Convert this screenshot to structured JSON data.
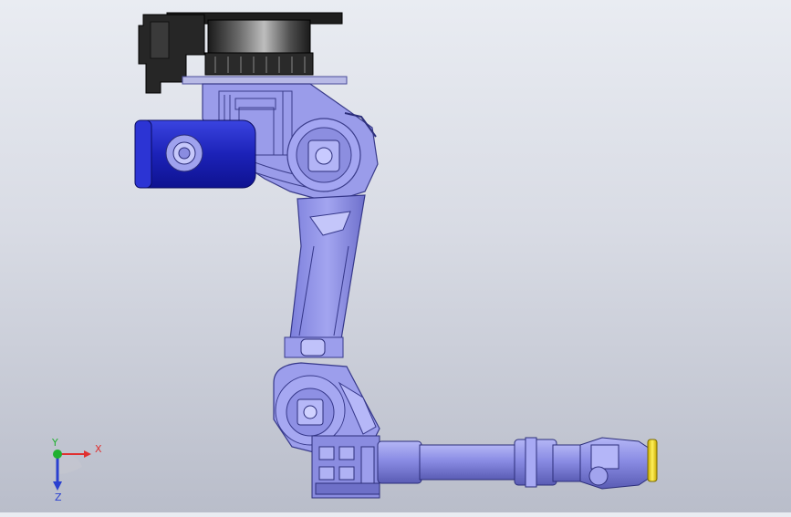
{
  "viewport": {
    "background_top": "#e9ecf2",
    "background_bottom": "#b9bdca",
    "model_color": "#8e90e6",
    "model_shadow": "#5a5cb0",
    "motor_color": "#2a32c8",
    "base_color": "#2b2b2b",
    "flange_color": "#f0d400"
  },
  "triad": {
    "x_label": "X",
    "y_label": "Y",
    "z_label": "Z",
    "x_color": "#e03030",
    "y_color": "#20b030",
    "z_color": "#2a40d0"
  }
}
